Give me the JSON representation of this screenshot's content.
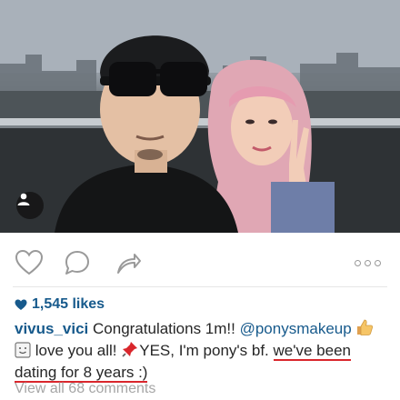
{
  "post": {
    "likes": "1,545 likes",
    "caption": {
      "username": "vivus_vici",
      "text_part1": " Congratulations 1m!! ",
      "mention": "@ponysmakeup",
      "text_part2": " love you all! ",
      "text_part3": "YES, I'm pony's bf. ",
      "highlight_part1": "we've been",
      "highlight_part2": "dating for 8 years :)"
    },
    "view_comments": "View all 68 comments"
  },
  "icons": {
    "like": "heart-outline-icon",
    "comment": "speech-bubble-icon",
    "share": "share-arrow-icon",
    "more": "more-dots-icon",
    "user_tag": "person-icon"
  },
  "colors": {
    "link_blue": "#175a8c",
    "highlight_red": "#d9262c",
    "muted_gray": "#a6a6a6"
  }
}
